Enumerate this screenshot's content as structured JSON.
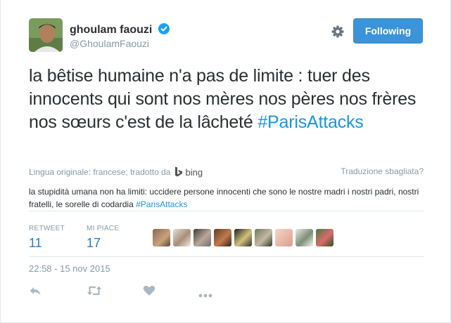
{
  "user": {
    "fullname": "ghoulam faouzi",
    "handle": "@GhoulamFaouzi"
  },
  "follow_button": {
    "label": "Following"
  },
  "tweet": {
    "text": "la bêtise humaine n'a pas de limite : tuer des innocents qui sont nos mères nos pères nos frères nos sœurs c'est de la lâcheté",
    "hashtag": "#ParisAttacks"
  },
  "translation": {
    "meta": "Lingua originale: francese; tradotto da",
    "engine": "bing",
    "wrong_link": "Traduzione sbagliata?",
    "text": "la stupidità umana non ha limiti: uccidere persone innocenti che sono le nostre madri i nostri padri, nostri fratelli, le sorelle di codardia",
    "hashtag": "#ParisAttacks"
  },
  "stats": {
    "retweet_label": "RETWEET",
    "retweet_count": "11",
    "likes_label": "MI PIACE",
    "likes_count": "17",
    "liker_avatars": [
      "liker-1",
      "liker-2",
      "liker-3",
      "liker-4",
      "liker-5",
      "liker-6",
      "liker-7",
      "liker-8",
      "liker-9"
    ]
  },
  "timestamp": "22:58 - 15 nov 2015",
  "actions": [
    "reply-icon",
    "retweet-icon",
    "like-heart-icon",
    "more-icon"
  ],
  "colors": {
    "link_blue": "#1b95e0",
    "button_blue": "#3b94d9",
    "stat_blue": "#2b7bb9",
    "muted_gray": "#8899a6",
    "text_dark": "#292f33"
  }
}
